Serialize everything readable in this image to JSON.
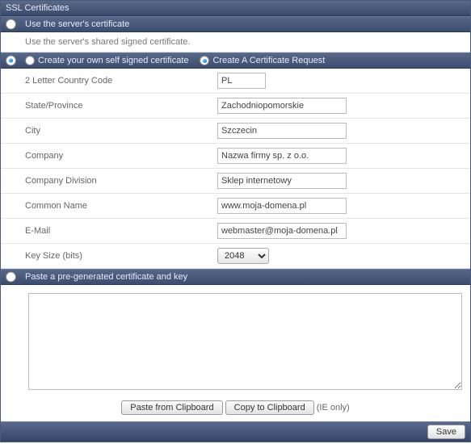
{
  "title": "SSL Certificates",
  "section1": {
    "label": "Use the server's certificate",
    "desc": "Use the server's shared signed certificate.",
    "selected": false
  },
  "section2": {
    "selected": true,
    "opt_self": {
      "label": "Create your own self signed certificate",
      "selected": false
    },
    "opt_req": {
      "label": "Create A Certificate Request",
      "selected": true
    },
    "fields": {
      "country": {
        "label": "2 Letter Country Code",
        "value": "PL"
      },
      "state": {
        "label": "State/Province",
        "value": "Zachodniopomorskie"
      },
      "city": {
        "label": "City",
        "value": "Szczecin"
      },
      "company": {
        "label": "Company",
        "value": "Nazwa firmy sp. z o.o."
      },
      "division": {
        "label": "Company Division",
        "value": "Sklep internetowy"
      },
      "cn": {
        "label": "Common Name",
        "value": "www.moja-domena.pl"
      },
      "email": {
        "label": "E-Mail",
        "value": "webmaster@moja-domena.pl"
      },
      "keysize": {
        "label": "Key Size (bits)",
        "value": "2048"
      }
    }
  },
  "section3": {
    "label": "Paste a pre-generated certificate and key",
    "selected": false,
    "textarea": "",
    "paste_btn": "Paste from Clipboard",
    "copy_btn": "Copy to Clipboard",
    "ie_note": "(IE only)"
  },
  "footer": {
    "save": "Save"
  }
}
